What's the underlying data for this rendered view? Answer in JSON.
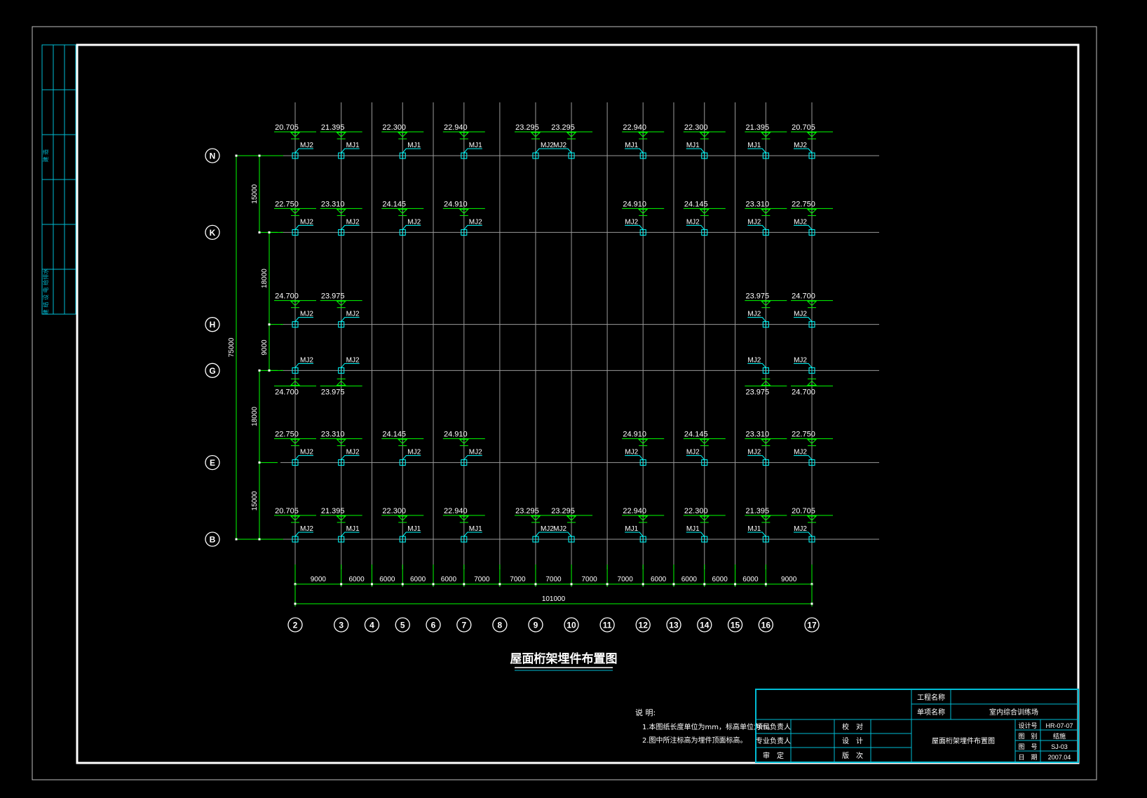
{
  "colors": {
    "background": "#000000",
    "grid": "#9a9a9a",
    "dimension": "#00ff00",
    "label": "#ffffff",
    "embed": "#00ffff",
    "frame": "#ffffff",
    "thin_frame": "#bfbfbf"
  },
  "title": "屋面桁架埋件布置图",
  "columns": [
    {
      "label": "2",
      "mm": 0
    },
    {
      "label": "3",
      "mm": 9000
    },
    {
      "label": "4",
      "mm": 15000
    },
    {
      "label": "5",
      "mm": 21000
    },
    {
      "label": "6",
      "mm": 27000
    },
    {
      "label": "7",
      "mm": 33000
    },
    {
      "label": "8",
      "mm": 40000
    },
    {
      "label": "9",
      "mm": 47000
    },
    {
      "label": "10",
      "mm": 54000
    },
    {
      "label": "11",
      "mm": 61000
    },
    {
      "label": "12",
      "mm": 68000
    },
    {
      "label": "13",
      "mm": 74000
    },
    {
      "label": "14",
      "mm": 80000
    },
    {
      "label": "15",
      "mm": 86000
    },
    {
      "label": "16",
      "mm": 92000
    },
    {
      "label": "17",
      "mm": 101000
    }
  ],
  "rows": [
    {
      "label": "N",
      "mm": 75000
    },
    {
      "label": "K",
      "mm": 60000
    },
    {
      "label": "H",
      "mm": 42000
    },
    {
      "label": "G",
      "mm": 33000
    },
    {
      "label": "E",
      "mm": 15000
    },
    {
      "label": "B",
      "mm": 0
    }
  ],
  "x_spacings": [
    "9000",
    "6000",
    "6000",
    "6000",
    "6000",
    "7000",
    "7000",
    "7000",
    "7000",
    "7000",
    "6000",
    "6000",
    "6000",
    "6000",
    "9000"
  ],
  "x_total": "101000",
  "y_spacings_outer": [
    "15000",
    "18000",
    "15000"
  ],
  "y_spacings_inner": [
    "18000",
    "9000"
  ],
  "y_total": "75000",
  "embeds": [
    {
      "row": "N",
      "col": "2",
      "elev": "20.705",
      "tag": "MJ2",
      "side": "r",
      "dir": "up"
    },
    {
      "row": "N",
      "col": "3",
      "elev": "21.395",
      "tag": "MJ1",
      "side": "r",
      "dir": "up"
    },
    {
      "row": "N",
      "col": "5",
      "elev": "22.300",
      "tag": "MJ1",
      "side": "r",
      "dir": "up"
    },
    {
      "row": "N",
      "col": "7",
      "elev": "22.940",
      "tag": "MJ1",
      "side": "r",
      "dir": "up"
    },
    {
      "row": "N",
      "col": "9",
      "elev": "23.295",
      "tag": "MJ2",
      "side": "r",
      "dir": "up"
    },
    {
      "row": "N",
      "col": "10",
      "elev": "23.295",
      "tag": "MJ2",
      "side": "l",
      "dir": "up"
    },
    {
      "row": "N",
      "col": "12",
      "elev": "22.940",
      "tag": "MJ1",
      "side": "l",
      "dir": "up"
    },
    {
      "row": "N",
      "col": "14",
      "elev": "22.300",
      "tag": "MJ1",
      "side": "l",
      "dir": "up"
    },
    {
      "row": "N",
      "col": "16",
      "elev": "21.395",
      "tag": "MJ1",
      "side": "l",
      "dir": "up"
    },
    {
      "row": "N",
      "col": "17",
      "elev": "20.705",
      "tag": "MJ2",
      "side": "l",
      "dir": "up"
    },
    {
      "row": "K",
      "col": "2",
      "elev": "22.750",
      "tag": "MJ2",
      "side": "r",
      "dir": "up"
    },
    {
      "row": "K",
      "col": "3",
      "elev": "23.310",
      "tag": "MJ2",
      "side": "r",
      "dir": "up"
    },
    {
      "row": "K",
      "col": "5",
      "elev": "24.145",
      "tag": "MJ2",
      "side": "r",
      "dir": "up"
    },
    {
      "row": "K",
      "col": "7",
      "elev": "24.910",
      "tag": "MJ2",
      "side": "r",
      "dir": "up"
    },
    {
      "row": "K",
      "col": "12",
      "elev": "24.910",
      "tag": "MJ2",
      "side": "l",
      "dir": "up"
    },
    {
      "row": "K",
      "col": "14",
      "elev": "24.145",
      "tag": "MJ2",
      "side": "l",
      "dir": "up"
    },
    {
      "row": "K",
      "col": "16",
      "elev": "23.310",
      "tag": "MJ2",
      "side": "l",
      "dir": "up"
    },
    {
      "row": "K",
      "col": "17",
      "elev": "22.750",
      "tag": "MJ2",
      "side": "l",
      "dir": "up"
    },
    {
      "row": "H",
      "col": "2",
      "elev": "24.700",
      "tag": "MJ2",
      "side": "r",
      "dir": "up"
    },
    {
      "row": "H",
      "col": "3",
      "elev": "23.975",
      "tag": "MJ2",
      "side": "r",
      "dir": "up"
    },
    {
      "row": "H",
      "col": "16",
      "elev": "23.975",
      "tag": "MJ2",
      "side": "l",
      "dir": "up"
    },
    {
      "row": "H",
      "col": "17",
      "elev": "24.700",
      "tag": "MJ2",
      "side": "l",
      "dir": "up"
    },
    {
      "row": "G",
      "col": "2",
      "elev": "24.700",
      "tag": "MJ2",
      "side": "r",
      "dir": "down"
    },
    {
      "row": "G",
      "col": "3",
      "elev": "23.975",
      "tag": "MJ2",
      "side": "r",
      "dir": "down"
    },
    {
      "row": "G",
      "col": "16",
      "elev": "23.975",
      "tag": "MJ2",
      "side": "l",
      "dir": "down"
    },
    {
      "row": "G",
      "col": "17",
      "elev": "24.700",
      "tag": "MJ2",
      "side": "l",
      "dir": "down"
    },
    {
      "row": "E",
      "col": "2",
      "elev": "22.750",
      "tag": "MJ2",
      "side": "r",
      "dir": "up"
    },
    {
      "row": "E",
      "col": "3",
      "elev": "23.310",
      "tag": "MJ2",
      "side": "r",
      "dir": "up"
    },
    {
      "row": "E",
      "col": "5",
      "elev": "24.145",
      "tag": "MJ2",
      "side": "r",
      "dir": "up"
    },
    {
      "row": "E",
      "col": "7",
      "elev": "24.910",
      "tag": "MJ2",
      "side": "r",
      "dir": "up"
    },
    {
      "row": "E",
      "col": "12",
      "elev": "24.910",
      "tag": "MJ2",
      "side": "l",
      "dir": "up"
    },
    {
      "row": "E",
      "col": "14",
      "elev": "24.145",
      "tag": "MJ2",
      "side": "l",
      "dir": "up"
    },
    {
      "row": "E",
      "col": "16",
      "elev": "23.310",
      "tag": "MJ2",
      "side": "l",
      "dir": "up"
    },
    {
      "row": "E",
      "col": "17",
      "elev": "22.750",
      "tag": "MJ2",
      "side": "l",
      "dir": "up"
    },
    {
      "row": "B",
      "col": "2",
      "elev": "20.705",
      "tag": "MJ2",
      "side": "r",
      "dir": "up"
    },
    {
      "row": "B",
      "col": "3",
      "elev": "21.395",
      "tag": "MJ1",
      "side": "r",
      "dir": "up"
    },
    {
      "row": "B",
      "col": "5",
      "elev": "22.300",
      "tag": "MJ1",
      "side": "r",
      "dir": "up"
    },
    {
      "row": "B",
      "col": "7",
      "elev": "22.940",
      "tag": "MJ1",
      "side": "r",
      "dir": "up"
    },
    {
      "row": "B",
      "col": "9",
      "elev": "23.295",
      "tag": "MJ2",
      "side": "r",
      "dir": "up"
    },
    {
      "row": "B",
      "col": "10",
      "elev": "23.295",
      "tag": "MJ2",
      "side": "l",
      "dir": "up"
    },
    {
      "row": "B",
      "col": "12",
      "elev": "22.940",
      "tag": "MJ1",
      "side": "l",
      "dir": "up"
    },
    {
      "row": "B",
      "col": "14",
      "elev": "22.300",
      "tag": "MJ1",
      "side": "l",
      "dir": "up"
    },
    {
      "row": "B",
      "col": "16",
      "elev": "21.395",
      "tag": "MJ1",
      "side": "l",
      "dir": "up"
    },
    {
      "row": "B",
      "col": "17",
      "elev": "20.705",
      "tag": "MJ2",
      "side": "l",
      "dir": "up"
    }
  ],
  "notes": {
    "heading": "说 明:",
    "lines": [
      "1.本图纸长度单位为mm，标高单位为m。",
      "2.图中所注标高为埋件顶面标高。"
    ]
  },
  "title_block": {
    "project_label": "工程名称",
    "project_value": "",
    "sub_label": "单项名称",
    "sub_value": "室内综合训练场",
    "roles": [
      "项目负责人",
      "专业负责人",
      "审　定"
    ],
    "checks": [
      "校　对",
      "设　计",
      "版　次"
    ],
    "drawing_name": "屋面桁架埋件布置图",
    "meta_labels": [
      "设计号",
      "图　别",
      "图　号",
      "日　期"
    ],
    "meta_values": [
      "HR-07-07",
      "结施",
      "SJ-03",
      "2007.04"
    ]
  },
  "side_strip": {
    "labels": [
      "建 造",
      "建 结 设 电 给排水"
    ]
  }
}
